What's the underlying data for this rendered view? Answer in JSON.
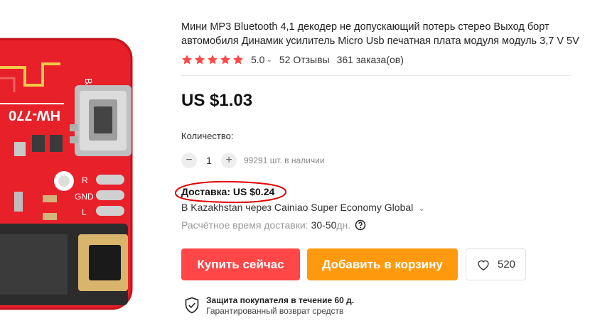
{
  "product": {
    "title": "Мини MP3 Bluetooth 4,1 декодер не допускающий потерь стерео Выход борт автомобиля Динамик усилитель Micro Usb печатная плата модуля модуль 3,7 V 5V",
    "image_alt": "HW-770 Bluetooth decoder board",
    "board_labels": {
      "model": "HW-770",
      "bat": "BAT",
      "r": "R",
      "gnd": "GND",
      "l": "L"
    }
  },
  "rating": {
    "stars": 5,
    "value": "5.0",
    "reviews": "52 Отзывы",
    "orders": "361 заказа(ов)",
    "star_color": "#ff4747"
  },
  "price": "US $1.03",
  "quantity": {
    "label": "Количество:",
    "value": "1",
    "decrement_icon": "minus-icon",
    "increment_icon": "plus-icon",
    "stock": "99291 шт. в наличии"
  },
  "shipping": {
    "label": "Доставка: US $0.24",
    "route": "В Kazakhstan через Cainiao Super Economy Global",
    "time_label": "Расчётное время доставки:",
    "time_value": "30-50",
    "time_unit": "дн.",
    "annotation_color": "#e00000"
  },
  "actions": {
    "buy_now": "Купить сейчас",
    "add_to_cart": "Добавить в корзину",
    "wishlist_count": "520",
    "buy_color": "#ff4747",
    "cart_color": "#ff9a0e"
  },
  "protection": {
    "title": "Защита покупателя в течение 60 д.",
    "subtitle": "Гарантированный возврат средств"
  }
}
